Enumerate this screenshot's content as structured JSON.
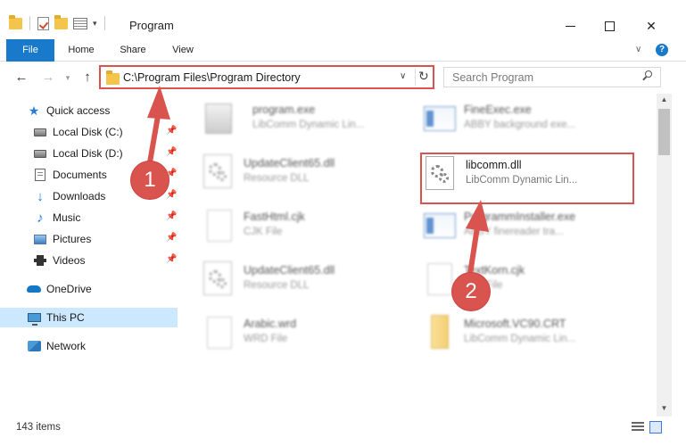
{
  "window": {
    "title": "Program"
  },
  "ribbon": {
    "tabs": [
      {
        "label": "File"
      },
      {
        "label": "Home"
      },
      {
        "label": "Share"
      },
      {
        "label": "View"
      }
    ]
  },
  "address": {
    "path": "C:\\Program Files\\Program Directory"
  },
  "search": {
    "placeholder": "Search Program"
  },
  "sidebar": {
    "items": [
      {
        "label": "Quick access",
        "icon": "star-icon"
      },
      {
        "label": "Local Disk (C:)",
        "icon": "drive-icon",
        "pinned": true
      },
      {
        "label": "Local Disk (D:)",
        "icon": "drive-icon",
        "pinned": true
      },
      {
        "label": "Documents",
        "icon": "documents-icon",
        "pinned": true
      },
      {
        "label": "Downloads",
        "icon": "downloads-icon",
        "pinned": true
      },
      {
        "label": "Music",
        "icon": "music-icon",
        "pinned": true
      },
      {
        "label": "Pictures",
        "icon": "pictures-icon",
        "pinned": true
      },
      {
        "label": "Videos",
        "icon": "videos-icon",
        "pinned": true
      },
      {
        "label": "OneDrive",
        "icon": "onedrive-icon"
      },
      {
        "label": "This PC",
        "icon": "this-pc-icon",
        "selected": true
      },
      {
        "label": "Network",
        "icon": "network-icon"
      }
    ]
  },
  "files": [
    {
      "name": "program.exe",
      "type": "LibComm Dynamic Lin...",
      "icon": "program-icon"
    },
    {
      "name": "FineExec.exe",
      "type": "ABBY background exe...",
      "icon": "application-icon"
    },
    {
      "name": "UpdateClient65.dll",
      "type": "Resource DLL",
      "icon": "dll-gear-icon"
    },
    {
      "name": "libcomm.dll",
      "type": "LibComm Dynamic Lin...",
      "icon": "dll-gear-icon"
    },
    {
      "name": "FastHtml.cjk",
      "type": "CJK File",
      "icon": "document-icon"
    },
    {
      "name": "ProgrammInstaller.exe",
      "type": "ABBY finereader tra...",
      "icon": "application-icon"
    },
    {
      "name": "UpdateClient65.dll",
      "type": "Resource DLL",
      "icon": "dll-gear-icon"
    },
    {
      "name": "TextKorn.cjk",
      "type": "CJK File",
      "icon": "document-icon"
    },
    {
      "name": "Arabic.wrd",
      "type": "WRD File",
      "icon": "document-icon"
    },
    {
      "name": "Microsoft.VC90.CRT",
      "type": "LibComm Dynamic Lin...",
      "icon": "folder-icon"
    }
  ],
  "status": {
    "item_count": "143 items"
  },
  "annotations": {
    "step1": "1",
    "step2": "2",
    "highlight_color": "#d9534f"
  },
  "colors": {
    "accent": "#1979ca",
    "selection": "#cce8ff"
  }
}
